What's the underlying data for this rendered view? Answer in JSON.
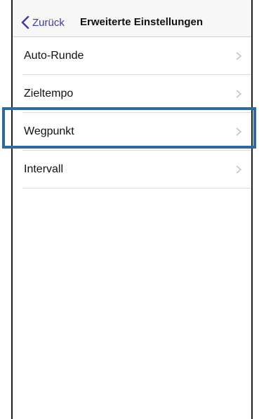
{
  "navbar": {
    "back_label": "Zurück",
    "title": "Erweiterte Einstellungen"
  },
  "list": {
    "items": [
      {
        "label": "Auto-Runde"
      },
      {
        "label": "Zieltempo"
      },
      {
        "label": "Wegpunkt",
        "highlighted": true
      },
      {
        "label": "Intervall"
      }
    ]
  },
  "colors": {
    "back_link": "#3a3aa8",
    "highlight_border": "#2a6aa8",
    "separator": "#dcdcdc",
    "chevron": "#c2c2c2"
  }
}
